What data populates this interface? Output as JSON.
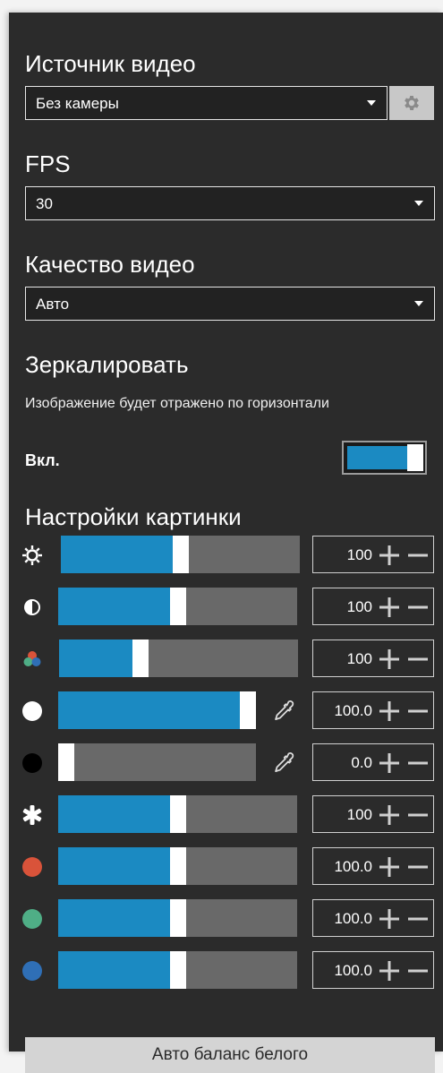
{
  "video_source": {
    "heading": "Источник видео",
    "selected": "Без камеры",
    "settings_icon": "gear-icon"
  },
  "fps": {
    "heading": "FPS",
    "selected": "30"
  },
  "quality": {
    "heading": "Качество видео",
    "selected": "Авто"
  },
  "mirror": {
    "heading": "Зеркалировать",
    "description": "Изображение будет отражено по горизонтали",
    "state_label": "Вкл.",
    "enabled": true
  },
  "picture": {
    "heading": "Настройки картинки",
    "rows": [
      {
        "name": "brightness",
        "icon": "sun-icon",
        "value": "100",
        "level": 0.5
      },
      {
        "name": "contrast",
        "icon": "contrast-icon",
        "value": "100",
        "level": 0.5
      },
      {
        "name": "saturation",
        "icon": "color-dots-icon",
        "value": "100",
        "level": 0.33
      },
      {
        "name": "white-point",
        "icon": "white-circle-icon",
        "value": "100.0",
        "level": 1.0,
        "eyedropper": true
      },
      {
        "name": "black-point",
        "icon": "black-circle-icon",
        "value": "0.0",
        "level": 0.0,
        "eyedropper": true
      },
      {
        "name": "sharpness",
        "icon": "asterisk-icon",
        "value": "100",
        "level": 0.5
      },
      {
        "name": "red",
        "icon": "red-circle-icon",
        "value": "100.0",
        "level": 0.5
      },
      {
        "name": "green",
        "icon": "green-circle-icon",
        "value": "100.0",
        "level": 0.5
      },
      {
        "name": "blue",
        "icon": "blue-circle-icon",
        "value": "100.0",
        "level": 0.5
      }
    ]
  },
  "auto_white_balance": {
    "label": "Авто баланс белого"
  },
  "colors": {
    "accent": "#1b8ac2",
    "track": "#696969",
    "panel": "#2b2b2b",
    "red": "#d9533a",
    "green": "#4fae86",
    "blue": "#2f6fb6"
  }
}
